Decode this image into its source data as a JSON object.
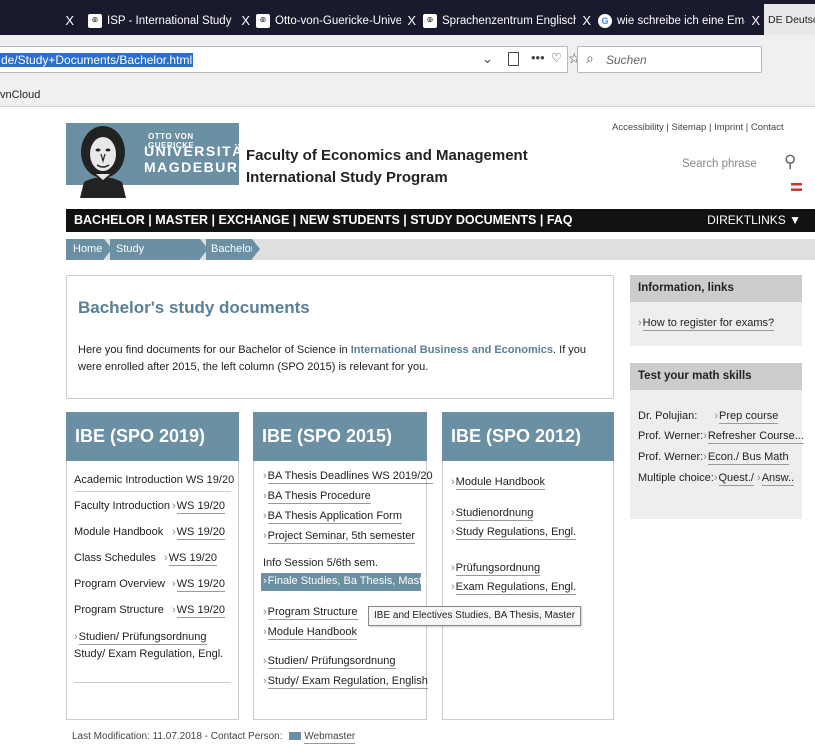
{
  "browser": {
    "tabs": [
      {
        "title": "",
        "close": "X"
      },
      {
        "title": "ISP - International Study Progra",
        "close": "X"
      },
      {
        "title": "Otto-von-Guericke-Universität",
        "close": "X"
      },
      {
        "title": "Sprachenzentrum Englisch (UN",
        "close": "X"
      },
      {
        "title": "wie schreibe ich eine Email Stu",
        "close": "X"
      },
      {
        "title": "DE Deutsch",
        "close": ""
      }
    ],
    "url": "de/Study+Documents/Bachelor.html",
    "search_placeholder": "Suchen",
    "bookmark": "vnCloud"
  },
  "header": {
    "logo_line1": "OTTO VON GUERICKE",
    "logo_line2": "UNIVERSITÄT",
    "logo_line3": "MAGDEBURG",
    "faculty": "Faculty of Economics and Management",
    "program": "International Study Program",
    "toplinks": "Accessibility | Sitemap | Imprint | Contact",
    "search_placeholder": "Search phrase"
  },
  "nav": {
    "items": "BACHELOR | MASTER | EXCHANGE | NEW STUDENTS | STUDY DOCUMENTS | FAQ",
    "direktlinks": "DIREKTLINKS ▼"
  },
  "breadcrumb": [
    "Home",
    "Study Documents",
    "Bachelor"
  ],
  "intro": {
    "title": "Bachelor's study documents",
    "text_before": "Here you find documents for our Bachelor of Science in ",
    "highlight": "International Business and Economics",
    "text_after": ". If you were enrolled after 2015, the left column (SPO 2015) is relevant for you."
  },
  "col2019": {
    "title": "IBE (SPO 2019)",
    "rows": [
      {
        "label": "Academic Introduction WS 19/20",
        "link": ""
      },
      {
        "label": "Faculty Introduction",
        "link": "WS 19/20"
      },
      {
        "label": "Module Handbook",
        "link": "WS 19/20"
      },
      {
        "label": "Class Schedules",
        "link": "WS 19/20"
      },
      {
        "label": "Program Overview",
        "link": "WS 19/20"
      },
      {
        "label": "Program Structure",
        "link": "WS 19/20"
      }
    ],
    "studien": "Studien/ Prüfungsordnung",
    "study_exam": "Study/ Exam Regulation, Engl."
  },
  "col2015": {
    "title": "IBE (SPO 2015)",
    "links": [
      "BA Thesis Deadlines WS 2019/20",
      "BA Thesis Procedure",
      "BA Thesis Application Form",
      "Project Seminar, 5th semester"
    ],
    "info": "Info  Session 5/6th sem.",
    "links2": [
      "Finale Studies, Ba Thesis, Master"
    ],
    "links3": [
      "Program Structure",
      "Module Handbook"
    ],
    "links4": [
      "Studien/ Prüfungsordnung",
      "Study/ Exam Regulation, English"
    ]
  },
  "col2012": {
    "title": "IBE (SPO 2012)",
    "links": [
      "Module Handbook",
      "Studienordnung",
      "Study Regulations, Engl.",
      "Prüfungsordnung",
      "Exam Regulations, Engl."
    ]
  },
  "sidebar": {
    "info_title": "Information, links",
    "info_link": "How to register for exams?",
    "math_title": "Test your math skills",
    "math_rows": [
      {
        "label": "Dr. Polujian:",
        "link": "Prep course"
      },
      {
        "label": "Prof. Werner:",
        "link": "Refresher Course..."
      },
      {
        "label": "Prof. Werner:",
        "link": "Econ./ Bus Math"
      },
      {
        "label": "Multiple choice:",
        "link": "Quest./",
        "link2": "Answ.."
      }
    ]
  },
  "tooltip": "IBE and Electives Studies, BA Thesis, Master",
  "footer": {
    "text": "Last Modification: 11.07.2018 - Contact Person:",
    "webmaster": "Webmaster"
  }
}
